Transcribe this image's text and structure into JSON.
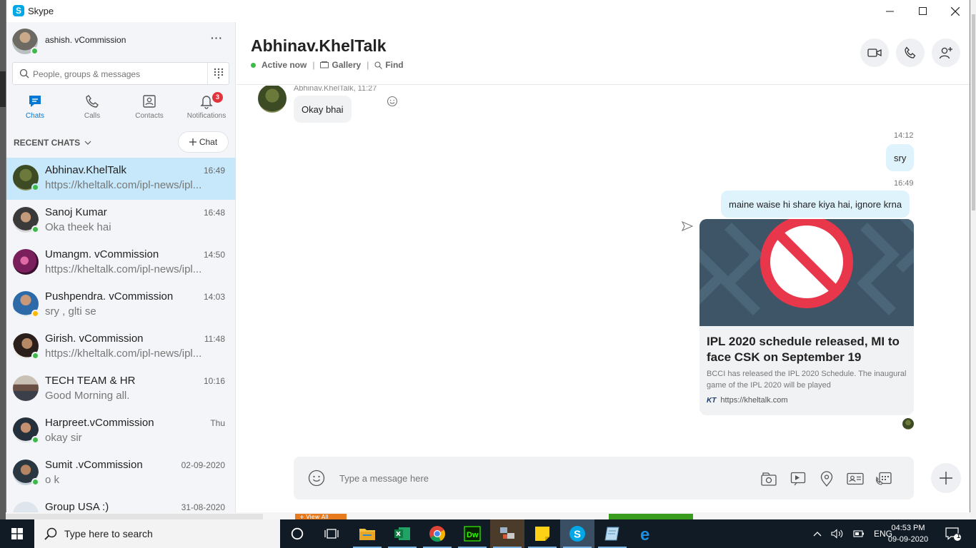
{
  "app": {
    "title": "Skype",
    "accent": "#0078d4"
  },
  "profile": {
    "name": "ashish. vCommission",
    "more_label": "···"
  },
  "search": {
    "placeholder": "People, groups & messages"
  },
  "nav": {
    "tabs": [
      {
        "label": "Chats",
        "icon": "chat-icon",
        "active": true
      },
      {
        "label": "Calls",
        "icon": "phone-icon"
      },
      {
        "label": "Contacts",
        "icon": "contacts-icon"
      },
      {
        "label": "Notifications",
        "icon": "bell-icon",
        "badge": "3"
      }
    ]
  },
  "recent": {
    "header": "RECENT CHATS",
    "new_chat_label": "Chat"
  },
  "chats": [
    {
      "name": "Abhinav.KhelTalk",
      "time": "16:49",
      "preview": "https://kheltalk.com/ipl-news/ipl...",
      "selected": true,
      "status": "online"
    },
    {
      "name": "Sanoj Kumar",
      "time": "16:48",
      "preview": "Oka theek hai",
      "status": "online"
    },
    {
      "name": "Umangm. vCommission",
      "time": "14:50",
      "preview": "https://kheltalk.com/ipl-news/ipl...",
      "status": "none"
    },
    {
      "name": "Pushpendra. vCommission",
      "time": "14:03",
      "preview": "sry , glti se",
      "status": "away"
    },
    {
      "name": "Girish. vCommission",
      "time": "11:48",
      "preview": "https://kheltalk.com/ipl-news/ipl...",
      "status": "online"
    },
    {
      "name": "TECH TEAM & HR",
      "time": "10:16",
      "preview": "Good Morning all.",
      "status": "none"
    },
    {
      "name": "Harpreet.vCommission",
      "time": "Thu",
      "preview": "okay sir",
      "status": "online"
    },
    {
      "name": "Sumit .vCommission",
      "time": "02-09-2020",
      "preview": "o k",
      "status": "online"
    },
    {
      "name": "Group USA :)",
      "time": "31-08-2020",
      "preview": "",
      "status": "none"
    }
  ],
  "conversation": {
    "contact": "Abhinav.KhelTalk",
    "status": "Active now",
    "gallery_label": "Gallery",
    "find_label": "Find",
    "incoming": {
      "sender_time": "Abhinav.KhelTalk, 11:27",
      "text": "Okay bhai"
    },
    "outgoing": [
      {
        "time": "14:12",
        "text": "sry"
      },
      {
        "time": "16:49",
        "text": "maine waise hi share kiya hai, ignore krna"
      }
    ],
    "link_card": {
      "title": "IPL 2020 schedule released, MI to face CSK on September 19",
      "description": "BCCI has released the IPL 2020 Schedule. The inaugural game of the IPL 2020 will be played",
      "site_logo": "KT",
      "url": "https://kheltalk.com"
    }
  },
  "composer": {
    "placeholder": "Type a message here"
  },
  "taskbar": {
    "search_text": "Type here to search",
    "language": "ENG",
    "time": "04:53 PM",
    "date": "09-09-2020",
    "notification_count": "1",
    "bg_button_label": "View All"
  }
}
